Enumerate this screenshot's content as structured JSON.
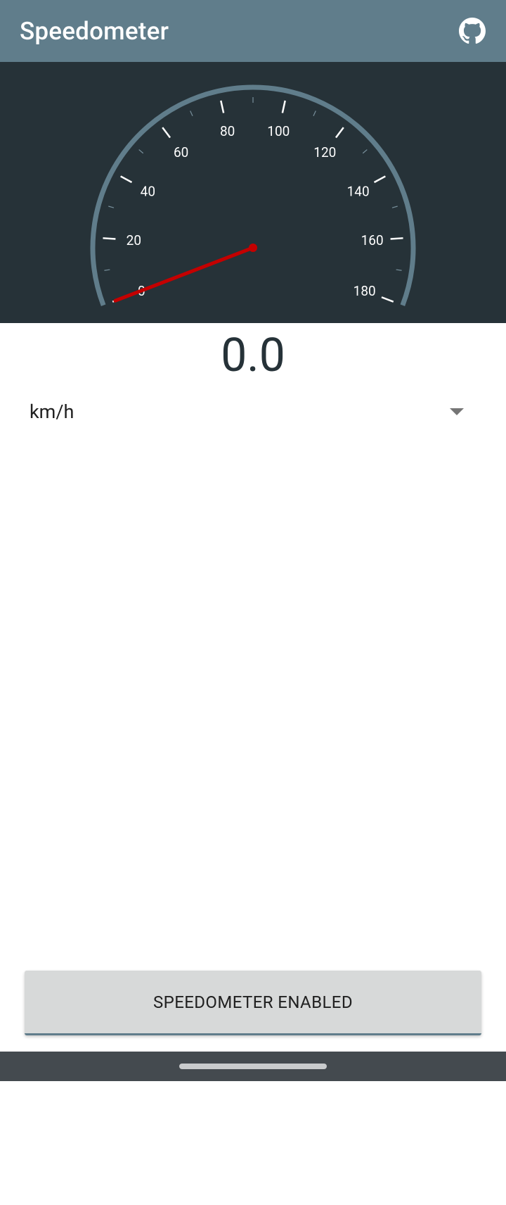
{
  "app_bar": {
    "title": "Speedometer",
    "action_icon": "github-icon"
  },
  "gauge": {
    "min": 0,
    "max": 180,
    "tick_labels": [
      "0",
      "20",
      "40",
      "60",
      "80",
      "100",
      "120",
      "140",
      "160",
      "180"
    ],
    "current_value": 0,
    "colors": {
      "arc": "#607d8b",
      "needle": "#c40000",
      "ticks": "#ffffff",
      "background": "#263238"
    }
  },
  "speed": {
    "value": "0.0"
  },
  "unit_selector": {
    "selected": "km/h",
    "icon": "arrow-drop-down-icon"
  },
  "toggle_button": {
    "label": "SPEEDOMETER ENABLED"
  },
  "theme": {
    "primary": "#607d8b",
    "dark": "#263238",
    "nav_bar": "#444a4f"
  }
}
